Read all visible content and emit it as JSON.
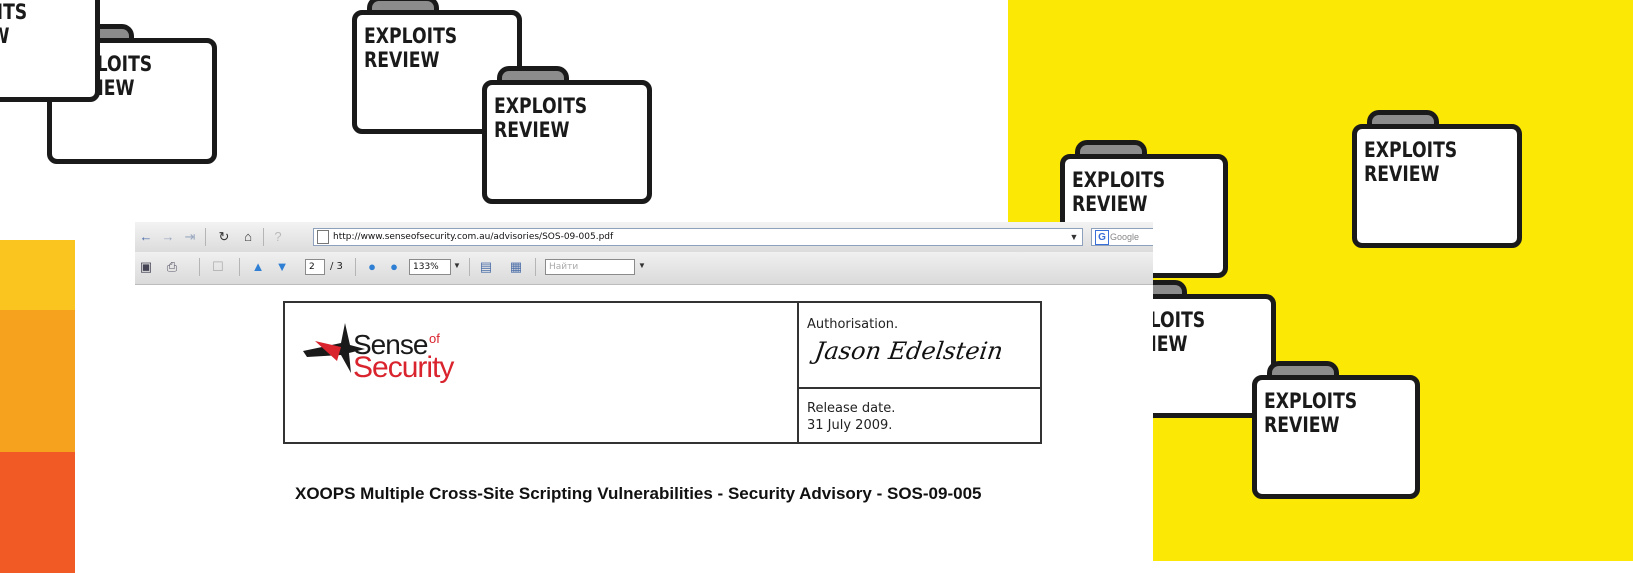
{
  "folders": [
    {
      "label_line1": "EXPLOITS",
      "label_line2": "REVIEW"
    }
  ],
  "browser": {
    "url": "http://www.senseofsecurity.com.au/advisories/SOS-09-005.pdf",
    "search_engine": "Google",
    "page_current": "2",
    "page_total": "/ 3",
    "zoom": "133%",
    "find_placeholder": "Найти"
  },
  "document": {
    "logo_sense": "Sense",
    "logo_of": "of",
    "logo_security": "Security",
    "authorisation_label": "Authorisation.",
    "signature": "Jason Edelstein",
    "release_label": "Release date.",
    "release_date": "31 July 2009.",
    "advisory_title": "XOOPS Multiple Cross-Site Scripting Vulnerabilities - Security Advisory - SOS-09-005"
  },
  "colors": {
    "yellow": "#fbe905",
    "stripe_top": "#fbc51f",
    "stripe_mid": "#f7a21e",
    "stripe_bottom": "#f15a24",
    "logo_red": "#d9232d"
  }
}
